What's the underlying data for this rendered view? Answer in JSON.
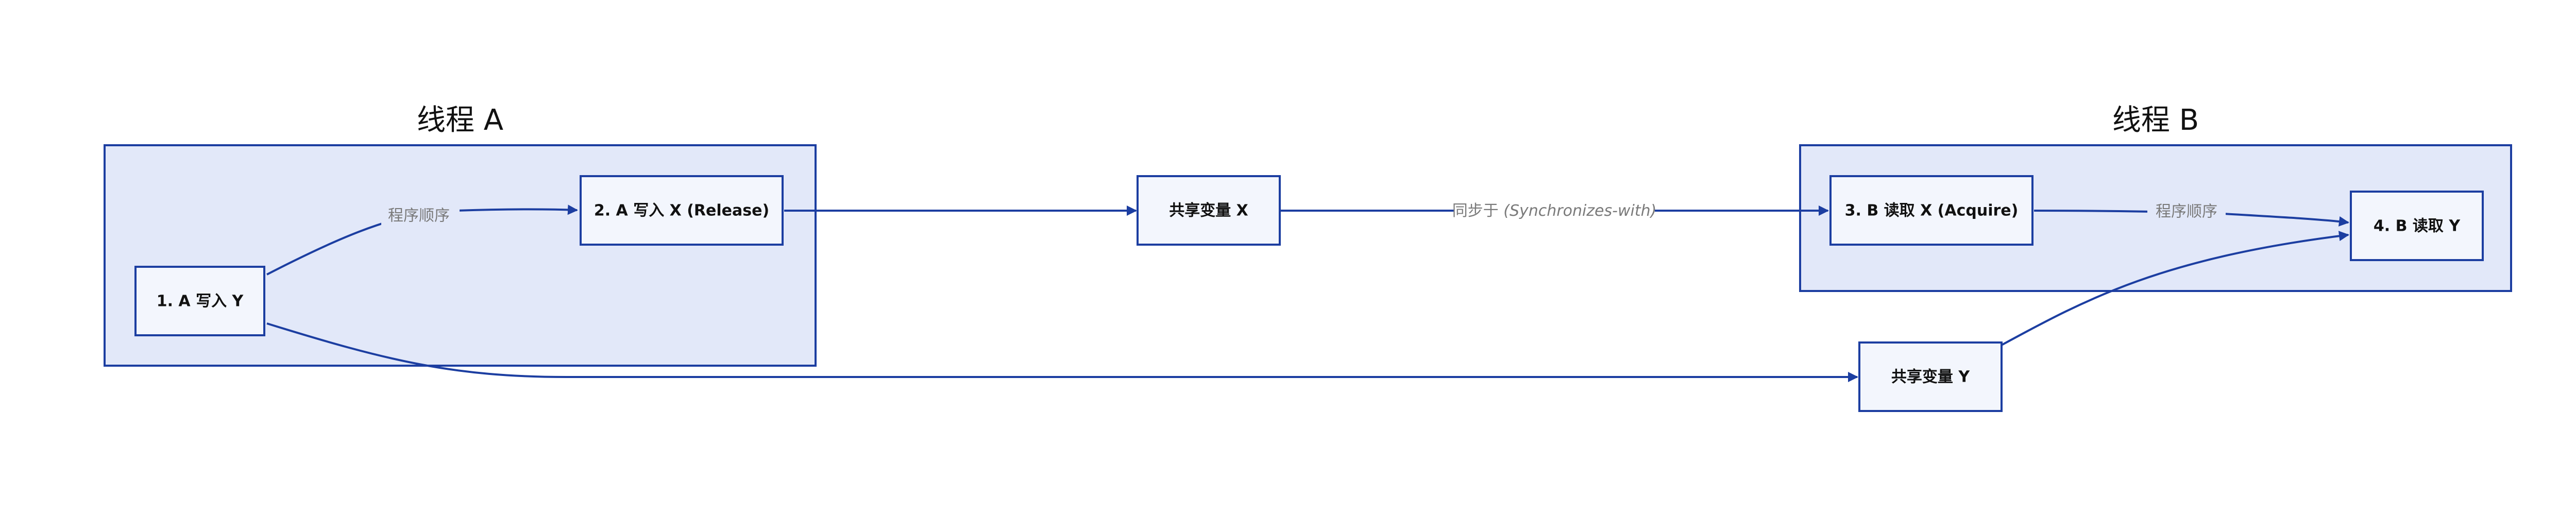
{
  "clusters": {
    "thread_a": {
      "title": "线程 A"
    },
    "thread_b": {
      "title": "线程 B"
    }
  },
  "nodes": {
    "a_write_y": "1. A 写入 Y",
    "a_write_x_release": "2. A 写入 X (Release)",
    "shared_x": "共享变量 X",
    "b_read_x_acquire": "3. B 读取 X (Acquire)",
    "b_read_y": "4. B 读取 Y",
    "shared_y": "共享变量 Y"
  },
  "edges": {
    "program_order_a": "程序顺序",
    "program_order_b": "程序顺序",
    "synchronizes_prefix": "同步于 ",
    "synchronizes_term": "(Synchronizes-with)"
  },
  "colors": {
    "stroke": "#1c3ea1",
    "cluster_fill": "#e2e8f9",
    "node_fill": "#f3f6fd",
    "edge_label": "#7a7a7a"
  }
}
